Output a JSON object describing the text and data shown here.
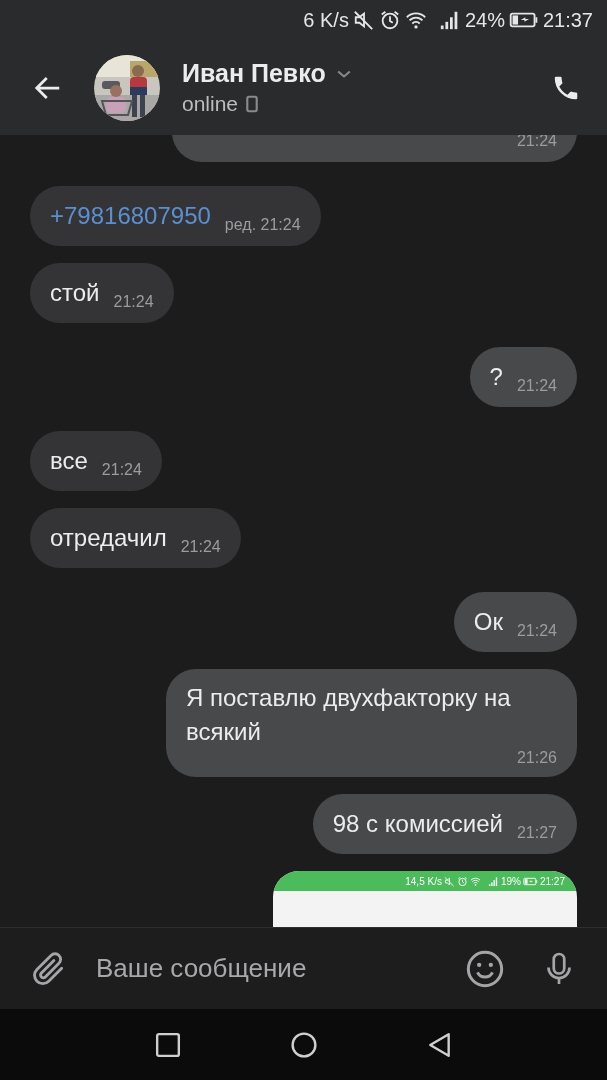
{
  "status_bar": {
    "speed": "6 K/s",
    "battery": "24%",
    "time": "21:37"
  },
  "header": {
    "name": "Иван Певко",
    "status": "online"
  },
  "messages": [
    {
      "kind": "text",
      "outgoing": true,
      "cut_top": true,
      "time": "21:24"
    },
    {
      "kind": "link",
      "outgoing": false,
      "text": "+79816807950",
      "time": "ред. 21:24"
    },
    {
      "kind": "text",
      "outgoing": false,
      "text": "стой",
      "time": "21:24"
    },
    {
      "kind": "text",
      "outgoing": true,
      "text": "?",
      "time": "21:24"
    },
    {
      "kind": "text",
      "outgoing": false,
      "text": "все",
      "time": "21:24"
    },
    {
      "kind": "text",
      "outgoing": false,
      "text": "отредачил",
      "time": "21:24"
    },
    {
      "kind": "text",
      "outgoing": true,
      "text": "Ок",
      "time": "21:24"
    },
    {
      "kind": "text",
      "outgoing": true,
      "text": "Я поставлю двухфакторку на всякий",
      "time": "21:26",
      "wrap": true
    },
    {
      "kind": "text",
      "outgoing": true,
      "text": "98 с комиссией",
      "time": "21:27"
    },
    {
      "kind": "screenshot",
      "outgoing": true,
      "status": {
        "speed": "14,5 K/s",
        "battery": "19%",
        "time": "21:27"
      }
    }
  ],
  "composer": {
    "placeholder": "Ваше сообщение"
  }
}
